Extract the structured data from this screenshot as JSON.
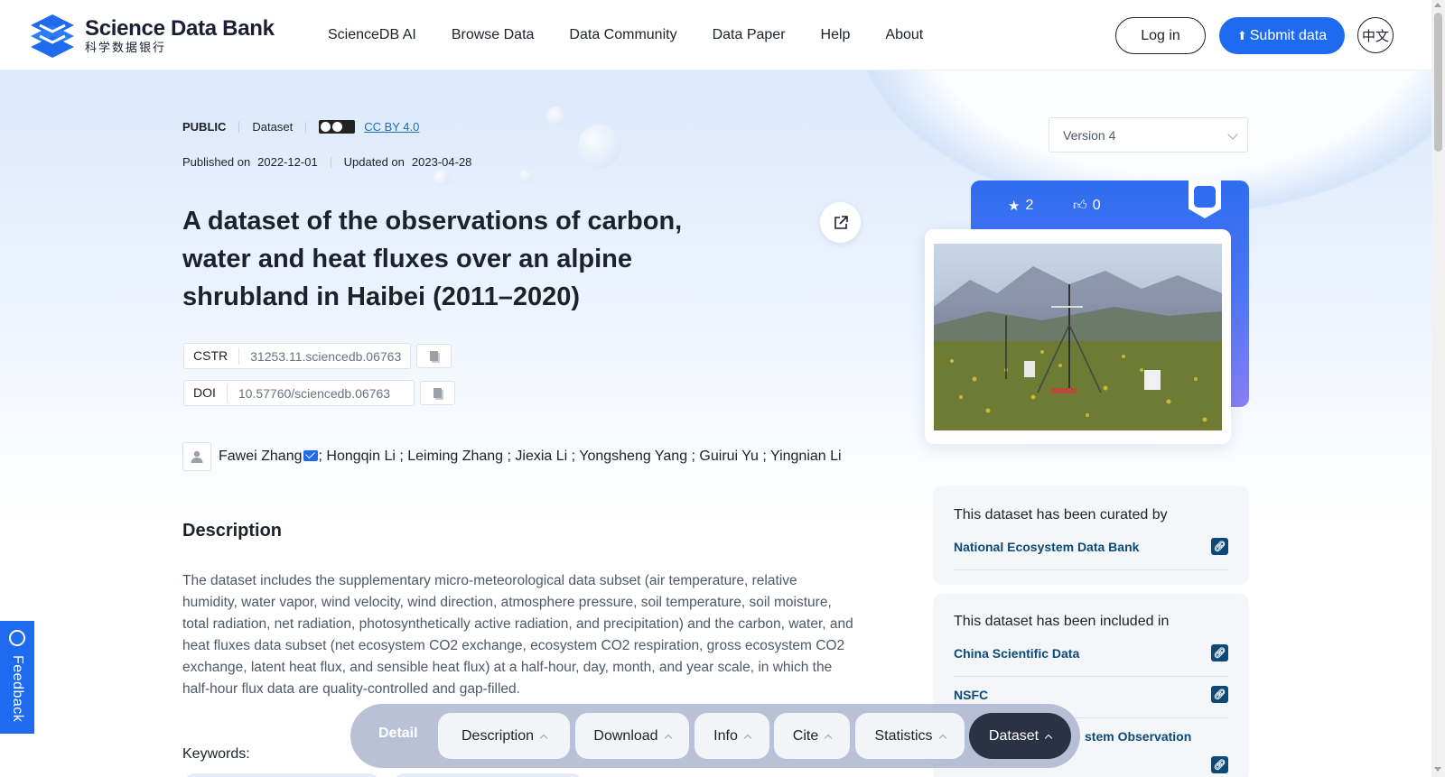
{
  "header": {
    "logo_en": "Science Data Bank",
    "logo_cn": "科学数据银行",
    "nav": [
      "ScienceDB AI",
      "Browse Data",
      "Data Community",
      "Data Paper",
      "Help",
      "About"
    ],
    "login": "Log in",
    "submit": "Submit data",
    "lang": "中文"
  },
  "meta": {
    "visibility": "PUBLIC",
    "type": "Dataset",
    "license": "CC BY 4.0",
    "published_label": "Published on",
    "published": "2022-12-01",
    "updated_label": "Updated on",
    "updated": "2023-04-28"
  },
  "version": "Version 4",
  "title": "A dataset of the observations of carbon, water and heat fluxes over an alpine shrubland in Haibei (2011–2020)",
  "identifiers": {
    "cstr_label": "CSTR",
    "cstr": "31253.11.sciencedb.06763",
    "doi_label": "DOI",
    "doi": "10.57760/sciencedb.06763"
  },
  "authors": {
    "first": "Fawei Zhang",
    "rest": "; Hongqin Li ; Leiming Zhang ; Jiexia Li ; Yongsheng Yang ; Guirui Yu ; Yingnian Li"
  },
  "description": {
    "heading": "Description",
    "text": "The dataset includes the supplementary micro-meteorological data subset (air temperature, relative humidity, water vapor, wind velocity, wind direction, atmosphere pressure, soil temperature, soil moisture, total radiation, net radiation, photosynthetically active radiation, and precipitation) and the carbon, water, and heat fluxes data subset (net ecosystem CO2 exchange, ecosystem CO2 respiration, gross ecosystem CO2 exchange, latent heat flux, and sensible heat flux) at a half-hour, day, month, and year scale, in which the half-hour flux data are quality-controlled and gap-filled.",
    "keywords_label": "Keywords:"
  },
  "stats": {
    "stars": "2",
    "likes": "0"
  },
  "curated": {
    "heading": "This dataset has been curated by",
    "items": [
      "National Ecosystem Data Bank"
    ]
  },
  "included": {
    "heading": "This dataset has been included in",
    "items": [
      "China Scientific Data",
      "NSFC",
      "stem Observation"
    ]
  },
  "feedback": "Feedback",
  "tabs": {
    "detail": "Detail",
    "items": [
      "Description",
      "Download",
      "Info",
      "Cite",
      "Statistics",
      "Dataset"
    ]
  },
  "colors": {
    "primary": "#1f6bf0",
    "link": "#0b4a78",
    "active_tab": "#2b3246"
  }
}
